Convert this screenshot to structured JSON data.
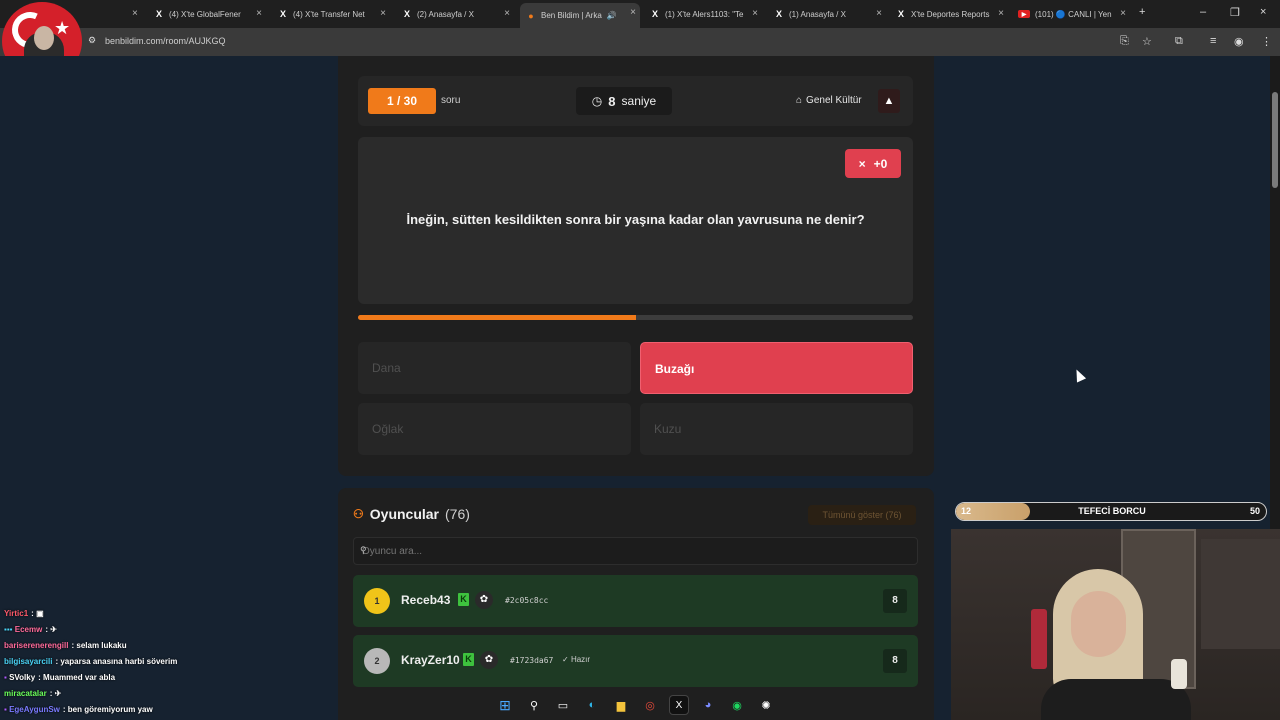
{
  "browser": {
    "tabs": [
      {
        "label": "(4) X'te GlobalFener",
        "icon": "x-logo-icon"
      },
      {
        "label": "(4) X'te Transfer Net",
        "icon": "x-logo-icon"
      },
      {
        "label": "(2) Anasayfa / X",
        "icon": "x-logo-icon"
      },
      {
        "label": "Ben Bildim | Arka",
        "icon": "benbildim-icon",
        "active": true
      },
      {
        "label": "(1) X'te Alers1103: \"Te",
        "icon": "x-logo-icon"
      },
      {
        "label": "(1) Anasayfa / X",
        "icon": "x-logo-icon"
      },
      {
        "label": "X'te Deportes Reports",
        "icon": "x-logo-icon"
      },
      {
        "label": "(101) 🔵 CANLI | Yen",
        "icon": "youtube-icon"
      }
    ],
    "url": "benbildim.com/room/AUJKGQ"
  },
  "game": {
    "question_number": "1 / 30",
    "question_label": "soru",
    "timer_value": "8",
    "timer_unit": "saniye",
    "category": "Genel Kültür",
    "score_delta": "+0",
    "question_text": "İneğin, sütten kesildikten sonra bir yaşına kadar olan yavrusuna ne denir?",
    "progress_fraction": 0.5,
    "answers": [
      {
        "label": "Dana",
        "selected": false
      },
      {
        "label": "Buzağı",
        "selected": true
      },
      {
        "label": "Oğlak",
        "selected": false
      },
      {
        "label": "Kuzu",
        "selected": false
      }
    ]
  },
  "players": {
    "title": "Oyuncular",
    "count": "(76)",
    "show_all": "Tümünü göster (76)",
    "search_placeholder": "Oyuncu ara...",
    "rows": [
      {
        "rank": "1",
        "name": "Receb43",
        "id": "#2c05c8cc",
        "ready": "",
        "score": "8",
        "rank_color": "#f0c419"
      },
      {
        "rank": "2",
        "name": "KrayZer10",
        "id": "#1723da67",
        "ready": "Hazır",
        "score": "8",
        "rank_color": "#b8b8b8"
      }
    ]
  },
  "chat": [
    {
      "user": "Yirtic1",
      "msg": ":",
      "color": "#ff5a6a"
    },
    {
      "user": "Ecemw",
      "msg": ":",
      "color": "#ff6a9a"
    },
    {
      "user": "bariserenerengill",
      "msg": ": selam lukaku",
      "color": "#ff6a9a"
    },
    {
      "user": "bilgisayarcili",
      "msg": ": yaparsa anasına harbi söverim",
      "color": "#4ad3f5"
    },
    {
      "user": "SVolky",
      "msg": ": Muammed var abla",
      "color": "#ffffff"
    },
    {
      "user": "miracatalar",
      "msg": ":",
      "color": "#6bff5a"
    },
    {
      "user": "EgeAygunSw",
      "msg": ": ben göremiyorum yaw",
      "color": "#7a7aff"
    }
  ],
  "overlay": {
    "low": "12",
    "title": "TEFECİ BORCU",
    "high": "50",
    "fill_fraction": 0.24
  }
}
